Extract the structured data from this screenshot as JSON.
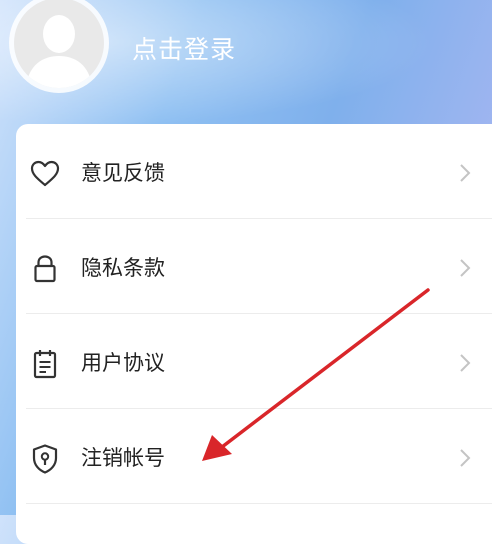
{
  "header": {
    "login_text": "点击登录"
  },
  "menu": {
    "items": [
      {
        "label": "意见反馈",
        "icon": "heart-icon"
      },
      {
        "label": "隐私条款",
        "icon": "lock-icon"
      },
      {
        "label": "用户协议",
        "icon": "document-icon"
      },
      {
        "label": "注销帐号",
        "icon": "shield-keyhole-icon"
      }
    ]
  },
  "colors": {
    "annotation_arrow": "#d9262a",
    "header_gradient_start": "#cfe2fb",
    "header_gradient_mid": "#7fb0ec",
    "chevron": "#c4c4c4"
  }
}
